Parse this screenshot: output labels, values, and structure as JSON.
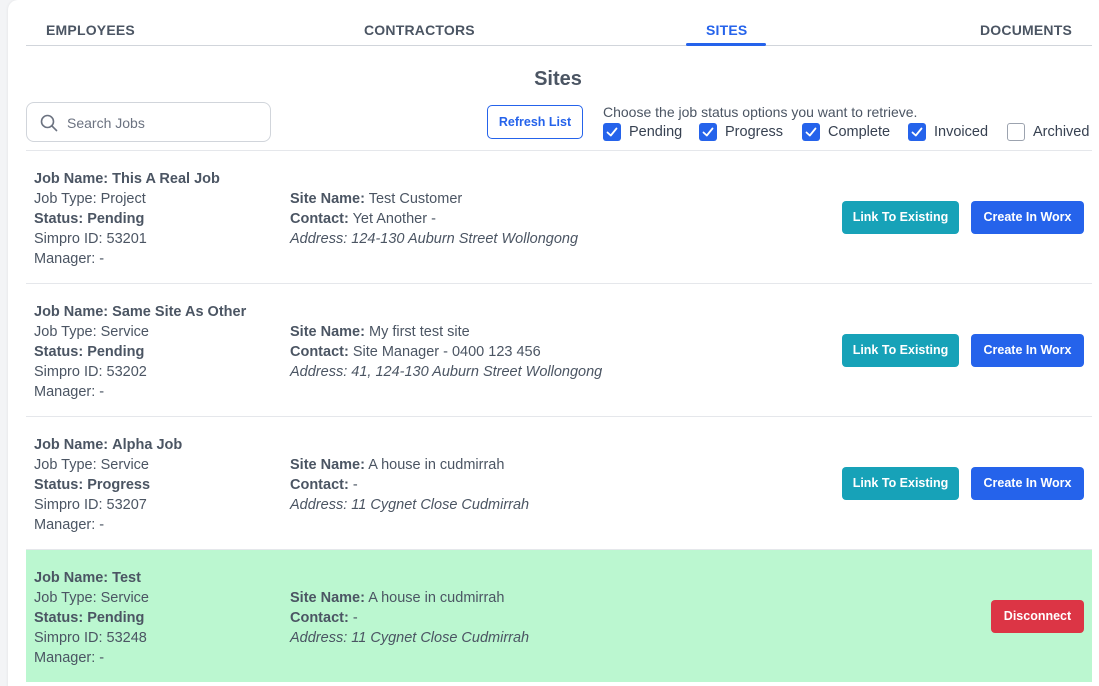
{
  "tabs": [
    {
      "label": "EMPLOYEES",
      "active": false
    },
    {
      "label": "CONTRACTORS",
      "active": false
    },
    {
      "label": "SITES",
      "active": true
    },
    {
      "label": "DOCUMENTS",
      "active": false
    }
  ],
  "page_title": "Sites",
  "search": {
    "placeholder": "Search Jobs",
    "value": "",
    "icon": "search-icon"
  },
  "refresh_label": "Refresh List",
  "status_filter": {
    "prompt": "Choose the job status options you want to retrieve.",
    "options": [
      {
        "label": "Pending",
        "checked": true
      },
      {
        "label": "Progress",
        "checked": true
      },
      {
        "label": "Complete",
        "checked": true
      },
      {
        "label": "Invoiced",
        "checked": true
      },
      {
        "label": "Archived",
        "checked": false
      }
    ]
  },
  "labels": {
    "job_name": "Job Name:",
    "job_type": "Job Type:",
    "status": "Status:",
    "simpro_id": "Simpro ID:",
    "manager": "Manager:",
    "site_name": "Site Name:",
    "contact": "Contact:",
    "address": "Address:"
  },
  "actions": {
    "link_existing": "Link To Existing",
    "create_worx": "Create In Worx",
    "disconnect": "Disconnect"
  },
  "colors": {
    "accent": "#2563eb",
    "link_button": "#17a2b8",
    "disconnect_button": "#dc3545",
    "linked_row_bg": "#bbf7d0"
  },
  "jobs": [
    {
      "job_name": "This A Real Job",
      "job_type": "Project",
      "status": "Pending",
      "simpro_id": "53201",
      "manager": "-",
      "site_name": "Test Customer",
      "contact": "Yet Another -",
      "address": "124-130 Auburn Street Wollongong",
      "linked": false
    },
    {
      "job_name": "Same Site As Other",
      "job_type": "Service",
      "status": "Pending",
      "simpro_id": "53202",
      "manager": "-",
      "site_name": "My first test site",
      "contact": "Site Manager - 0400 123 456",
      "address": "41, 124-130 Auburn Street Wollongong",
      "linked": false
    },
    {
      "job_name": "Alpha Job",
      "job_type": "Service",
      "status": "Progress",
      "simpro_id": "53207",
      "manager": "-",
      "site_name": "A house in cudmirrah",
      "contact": "-",
      "address": "11 Cygnet Close Cudmirrah",
      "linked": false
    },
    {
      "job_name": "Test",
      "job_type": "Service",
      "status": "Pending",
      "simpro_id": "53248",
      "manager": "-",
      "site_name": "A house in cudmirrah",
      "contact": "-",
      "address": "11 Cygnet Close Cudmirrah",
      "linked": true
    }
  ]
}
